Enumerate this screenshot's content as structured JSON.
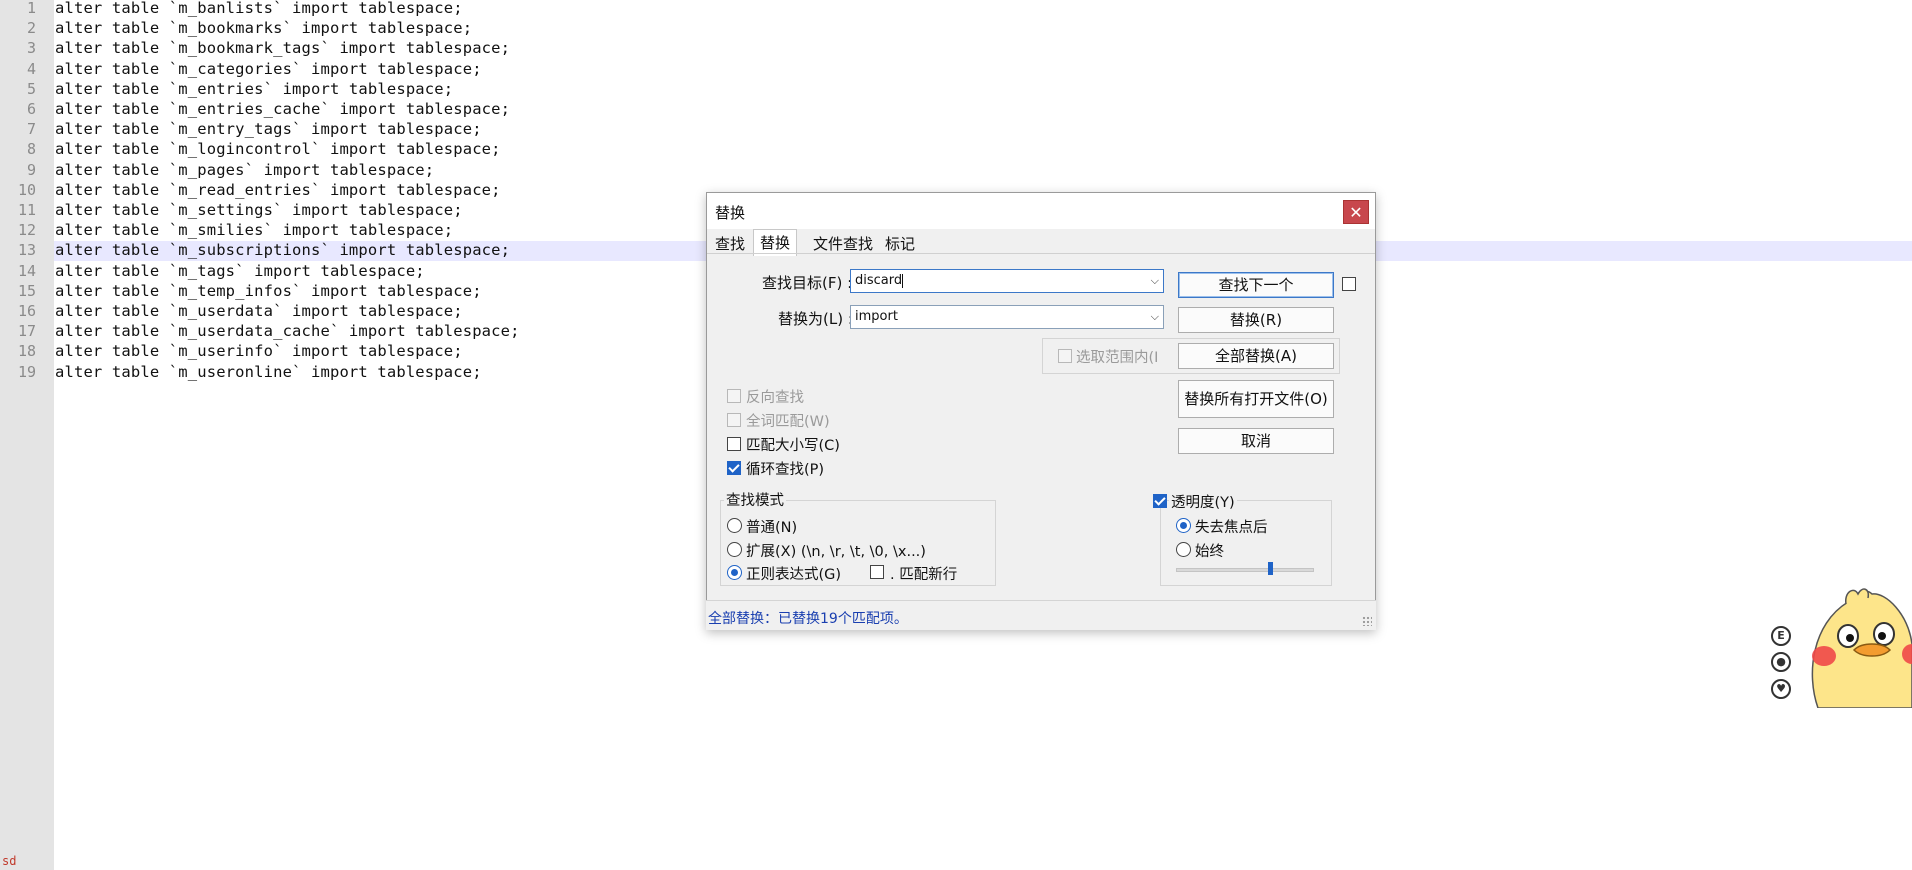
{
  "editor": {
    "line_numbers": [
      "1",
      "2",
      "3",
      "4",
      "5",
      "6",
      "7",
      "8",
      "9",
      "10",
      "11",
      "12",
      "13",
      "14",
      "15",
      "16",
      "17",
      "18",
      "19"
    ],
    "lines": [
      "alter table `m_banlists` import tablespace;",
      "alter table `m_bookmarks` import tablespace;",
      "alter table `m_bookmark_tags` import tablespace;",
      "alter table `m_categories` import tablespace;",
      "alter table `m_entries` import tablespace;",
      "alter table `m_entries_cache` import tablespace;",
      "alter table `m_entry_tags` import tablespace;",
      "alter table `m_logincontrol` import tablespace;",
      "alter table `m_pages` import tablespace;",
      "alter table `m_read_entries` import tablespace;",
      "alter table `m_settings` import tablespace;",
      "alter table `m_smilies` import tablespace;",
      "alter table `m_subscriptions` import tablespace;",
      "alter table `m_tags` import tablespace;",
      "alter table `m_temp_infos` import tablespace;",
      "alter table `m_userdata` import tablespace;",
      "alter table `m_userdata_cache` import tablespace;",
      "alter table `m_userinfo` import tablespace;",
      "alter table `m_useronline` import tablespace;"
    ],
    "current_line": 13,
    "corner_label": "sd",
    "highlight_color": "#e8e8ff"
  },
  "dialog": {
    "title": "替换",
    "close_label": "✕",
    "tabs": [
      "查找",
      "替换",
      "文件查找",
      "标记"
    ],
    "active_tab": "替换",
    "find_label": "查找目标(F) :",
    "find_value": "discard",
    "replace_label": "替换为(L) :",
    "replace_value": "import",
    "in_selection_label": "选取范围内(I",
    "buttons": {
      "find_next": "查找下一个",
      "replace": "替换(R)",
      "replace_all": "全部替换(A)",
      "replace_all_open": "替换所有打开文件(O)",
      "cancel": "取消"
    },
    "options": {
      "backward": "反向查找",
      "whole_word": "全词匹配(W)",
      "match_case": "匹配大小写(C)",
      "wrap_around": "循环查找(P)"
    },
    "search_mode": {
      "title": "查找模式",
      "normal": "普通(N)",
      "extended": "扩展(X) (\\n, \\r, \\t, \\0, \\x...)",
      "regex": "正则表达式(G)",
      "dot_newline": ". 匹配新行",
      "selected": "regex"
    },
    "transparency": {
      "title": "透明度(Y)",
      "on_lose_focus": "失去焦点后",
      "always": "始终",
      "selected": "on_lose_focus",
      "level": 0.68
    },
    "status": "全部替换：已替换19个匹配项。",
    "accent_color": "#1f63c7",
    "close_color": "#c8474d"
  }
}
